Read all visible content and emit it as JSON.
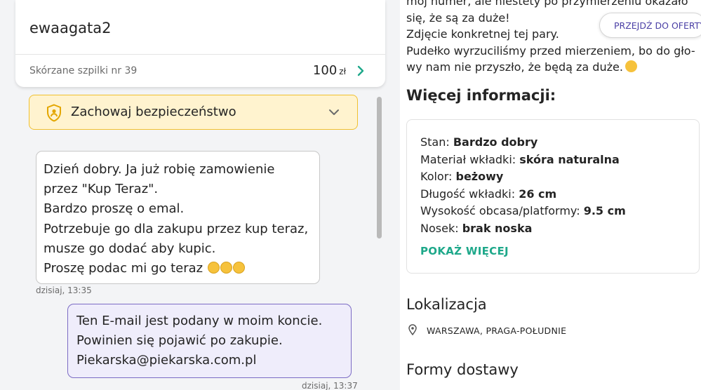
{
  "chat": {
    "username": "ewaagata2",
    "offer": {
      "title": "Skórzane szpilki nr 39",
      "price": "100",
      "currency": "zł"
    },
    "safety_label": "Zachowaj bezpieczeństwo",
    "incoming": {
      "lines": [
        "Dzień dobry. Ja już robię zamowienie",
        "przez \"Kup Teraz\".",
        "Bardzo proszę o emal.",
        "Potrzebuje go dla zakupu przez kup teraz,",
        "musze go dodać aby kupic.",
        "Proszę podac mi go teraz"
      ],
      "emoji_count": 3,
      "timestamp": "dzisiaj, 13:35"
    },
    "outgoing": {
      "lines": [
        "Ten E-mail jest podany w moim koncie.",
        "Powinien się pojawić po zakupie.",
        "Piekarska@piekarska.com.pl"
      ],
      "timestamp": "dzisiaj, 13:37"
    }
  },
  "offer_details": {
    "description_lines": [
      "mój numer, ale niestety po przymierzeniu okazało",
      "się, że są za duże!",
      "Zdjęcie konkretnej tej pary.",
      "Pudełko wyrzuciliśmy przed mierzeniem, bo do gło-",
      "wy nam nie przyszło, że będą za duże."
    ],
    "goto_button": "PRZEJDŹ DO OFERTY",
    "more_info_title": "Więcej informacji:",
    "attributes": [
      {
        "label": "Stan: ",
        "value": "Bardzo dobry"
      },
      {
        "label": "Materiał wkładki: ",
        "value": "skóra naturalna"
      },
      {
        "label": "Kolor: ",
        "value": "beżowy"
      },
      {
        "label": "Długość wkładki: ",
        "value": "26 cm"
      },
      {
        "label": "Wysokość obcasa/platformy: ",
        "value": "9.5 cm"
      },
      {
        "label": "Nosek: ",
        "value": "brak noska"
      }
    ],
    "show_more": "POKAŻ WIĘCEJ",
    "location_title": "Lokalizacja",
    "location": "WARSZAWA, PRAGA-POŁUDNIE",
    "delivery_title": "Formy dostawy"
  },
  "colors": {
    "accent_green": "#1ea88a",
    "accent_purple": "#4a3fa5",
    "warning_bg": "#fff3cf",
    "warning_border": "#f0c030"
  },
  "icons": [
    "chevron-right-icon",
    "shield-user-icon",
    "chevron-down-icon",
    "location-pin-icon",
    "emoji-icon",
    "facepalm-emoji-icon"
  ]
}
